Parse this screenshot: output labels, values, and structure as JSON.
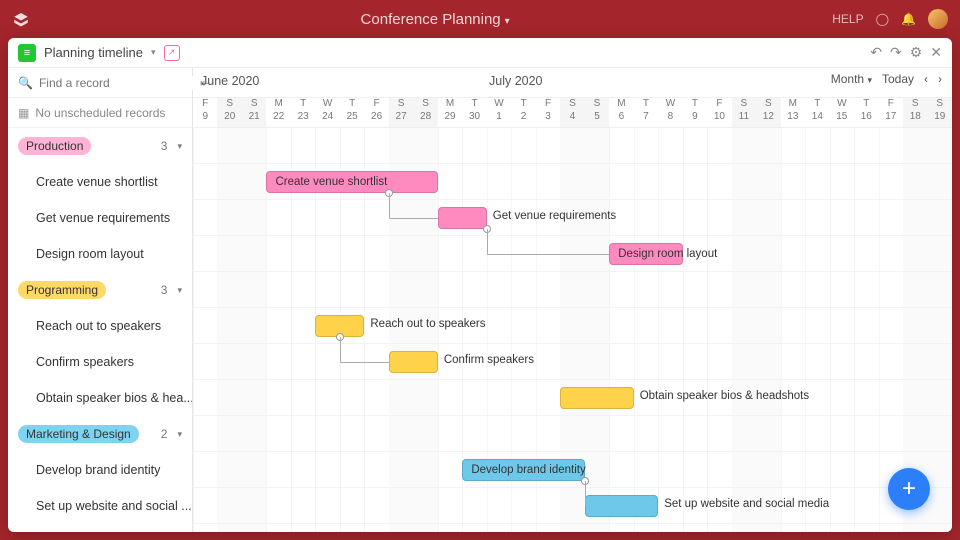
{
  "app": {
    "title": "Conference Planning",
    "help": "HELP"
  },
  "view": {
    "name": "Planning timeline"
  },
  "sidebar": {
    "find_placeholder": "Find a record",
    "no_unscheduled": "No unscheduled records",
    "groups": [
      {
        "name": "Production",
        "count": "3",
        "color": "#ff6fb1",
        "bg": "#ffb3d6",
        "tasks": [
          "Create venue shortlist",
          "Get venue requirements",
          "Design room layout"
        ]
      },
      {
        "name": "Programming",
        "count": "3",
        "color": "#c78f00",
        "bg": "#ffd966",
        "tasks": [
          "Reach out to speakers",
          "Confirm speakers",
          "Obtain speaker bios & hea..."
        ]
      },
      {
        "name": "Marketing & Design",
        "count": "2",
        "color": "#0090c7",
        "bg": "#7ed3f0",
        "tasks": [
          "Develop brand identity",
          "Set up website and social ..."
        ]
      }
    ]
  },
  "timeline": {
    "month1": "June 2020",
    "month2": "July 2020",
    "scale": "Month",
    "today": "Today",
    "days": [
      {
        "w": "F",
        "d": "9"
      },
      {
        "w": "S",
        "d": "20"
      },
      {
        "w": "S",
        "d": "21"
      },
      {
        "w": "M",
        "d": "22"
      },
      {
        "w": "T",
        "d": "23"
      },
      {
        "w": "W",
        "d": "24"
      },
      {
        "w": "T",
        "d": "25"
      },
      {
        "w": "F",
        "d": "26"
      },
      {
        "w": "S",
        "d": "27"
      },
      {
        "w": "S",
        "d": "28"
      },
      {
        "w": "M",
        "d": "29"
      },
      {
        "w": "T",
        "d": "30"
      },
      {
        "w": "W",
        "d": "1"
      },
      {
        "w": "T",
        "d": "2"
      },
      {
        "w": "F",
        "d": "3"
      },
      {
        "w": "S",
        "d": "4"
      },
      {
        "w": "S",
        "d": "5"
      },
      {
        "w": "M",
        "d": "6"
      },
      {
        "w": "T",
        "d": "7"
      },
      {
        "w": "W",
        "d": "8"
      },
      {
        "w": "T",
        "d": "9"
      },
      {
        "w": "F",
        "d": "10"
      },
      {
        "w": "S",
        "d": "11"
      },
      {
        "w": "S",
        "d": "12"
      },
      {
        "w": "M",
        "d": "13"
      },
      {
        "w": "T",
        "d": "14"
      },
      {
        "w": "W",
        "d": "15"
      },
      {
        "w": "T",
        "d": "16"
      },
      {
        "w": "F",
        "d": "17"
      },
      {
        "w": "S",
        "d": "18"
      },
      {
        "w": "S",
        "d": "19"
      }
    ],
    "bars": [
      {
        "row": 1,
        "start": 3,
        "end": 10,
        "color": "#ff8ac0",
        "text": "Create venue shortlist",
        "textIn": true
      },
      {
        "row": 2,
        "start": 10,
        "end": 12,
        "color": "#ff8ac0",
        "text": "Get venue requirements",
        "textIn": false
      },
      {
        "row": 3,
        "start": 17,
        "end": 20,
        "color": "#ff8ac0",
        "text": "Design room layout",
        "textIn": true
      },
      {
        "row": 5,
        "start": 5,
        "end": 7,
        "color": "#ffd24a",
        "text": "Reach out to speakers",
        "textIn": false
      },
      {
        "row": 6,
        "start": 8,
        "end": 10,
        "color": "#ffd24a",
        "text": "Confirm speakers",
        "textIn": false
      },
      {
        "row": 7,
        "start": 15,
        "end": 18,
        "color": "#ffd24a",
        "text": "Obtain speaker bios & headshots",
        "textIn": false
      },
      {
        "row": 9,
        "start": 11,
        "end": 16,
        "color": "#6ec8ea",
        "text": "Develop brand identity",
        "textIn": true
      },
      {
        "row": 10,
        "start": 16,
        "end": 19,
        "color": "#6ec8ea",
        "text": "Set up website and social media",
        "textIn": false
      }
    ]
  }
}
